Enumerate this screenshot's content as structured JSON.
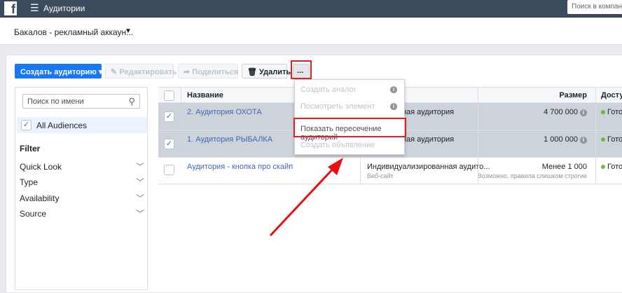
{
  "header": {
    "logo": "f",
    "title": "Аудитории",
    "search_placeholder": "Поиск в компании"
  },
  "account": {
    "name": "Бакалов - рекламный аккаун...",
    "caret": "▼"
  },
  "toolbar": {
    "create": "Создать аудиторию",
    "edit": "Редактировать",
    "share": "Поделиться",
    "delete": "Удалить",
    "more": "..."
  },
  "sidebar": {
    "search_placeholder": "Поиск по имени",
    "all_audiences": "All Audiences",
    "filter_title": "Filter",
    "filters": [
      "Quick Look",
      "Type",
      "Availability",
      "Source"
    ]
  },
  "table": {
    "columns": {
      "name": "Название",
      "size": "Размер",
      "availability": "Досту"
    },
    "rows": [
      {
        "name": "2. Аудитория ОХОТА",
        "type": "Сохраненная аудитория",
        "type_sub": "",
        "size": "4 700 000",
        "size_note": "",
        "status": "Готов",
        "checked": true
      },
      {
        "name": "1. Аудитория РЫБАЛКА",
        "type": "Сохраненная аудитория",
        "type_sub": "",
        "size": "1 000 000",
        "size_note": "",
        "status": "Готов",
        "checked": true
      },
      {
        "name": "Аудитория - кнопка про скайп",
        "type": "Индивидуализированная аудито...",
        "type_sub": "Веб-сайт",
        "size": "Менее 1 000",
        "size_note": "Возможно, правила слишком строгие",
        "status": "Готов",
        "checked": false
      }
    ]
  },
  "menu": {
    "items": [
      "Создать аналог",
      "Посмотреть элемент",
      "Показать пересечение аудиторий",
      "Создать объявление"
    ]
  },
  "colors": {
    "accent": "#1877f2",
    "highlight": "#e02020"
  }
}
